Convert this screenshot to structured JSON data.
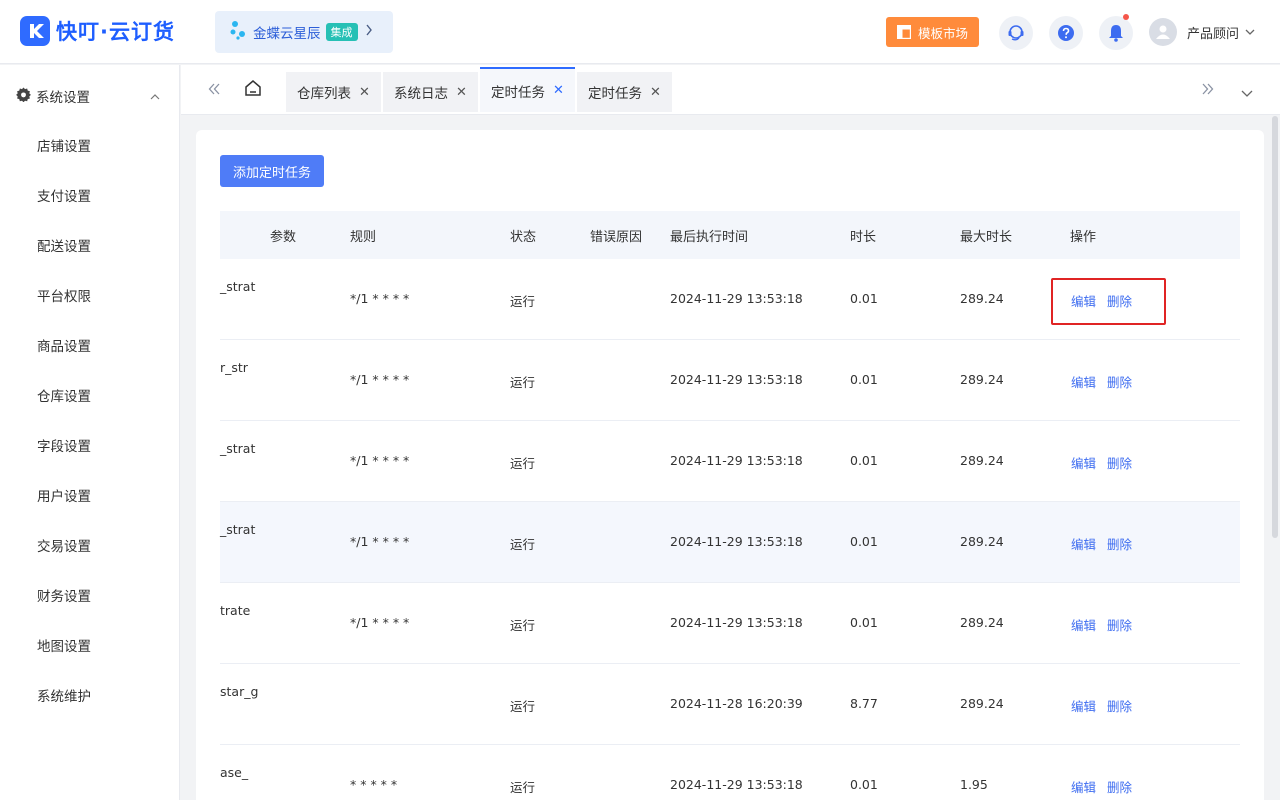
{
  "app": {
    "name": "快叮·云订货",
    "integration_label": "金蝶云星辰",
    "integration_badge": "集成",
    "market_button": "模板市场",
    "user_name": "产品顾问"
  },
  "sidebar": {
    "group_label": "系统设置",
    "items": [
      "店铺设置",
      "支付设置",
      "配送设置",
      "平台权限",
      "商品设置",
      "仓库设置",
      "字段设置",
      "用户设置",
      "交易设置",
      "财务设置",
      "地图设置",
      "系统维护"
    ]
  },
  "tabs": [
    {
      "label": "仓库列表",
      "active": false
    },
    {
      "label": "系统日志",
      "active": false
    },
    {
      "label": "定时任务",
      "active": true
    },
    {
      "label": "定时任务",
      "active": false
    }
  ],
  "main": {
    "add_button": "添加定时任务",
    "columns": [
      "参数",
      "规则",
      "状态",
      "错误原因",
      "最后执行时间",
      "时长",
      "最大时长",
      "操作"
    ],
    "rows": [
      {
        "param": "_strat",
        "rule": "*/1 * * * *",
        "status": "运行",
        "error": "",
        "last_run": "2024-11-29 13:53:18",
        "duration": "0.01",
        "max_duration": "289.24",
        "edit": "编辑",
        "delete": "删除"
      },
      {
        "param": "r_str",
        "rule": "*/1 * * * *",
        "status": "运行",
        "error": "",
        "last_run": "2024-11-29 13:53:18",
        "duration": "0.01",
        "max_duration": "289.24",
        "edit": "编辑",
        "delete": "删除"
      },
      {
        "param": "_strat",
        "rule": "*/1 * * * *",
        "status": "运行",
        "error": "",
        "last_run": "2024-11-29 13:53:18",
        "duration": "0.01",
        "max_duration": "289.24",
        "edit": "编辑",
        "delete": "删除"
      },
      {
        "param": "_strat",
        "rule": "*/1 * * * *",
        "status": "运行",
        "error": "",
        "last_run": "2024-11-29 13:53:18",
        "duration": "0.01",
        "max_duration": "289.24",
        "edit": "编辑",
        "delete": "删除"
      },
      {
        "param": "trate",
        "rule": "*/1 * * * *",
        "status": "运行",
        "error": "",
        "last_run": "2024-11-29 13:53:18",
        "duration": "0.01",
        "max_duration": "289.24",
        "edit": "编辑",
        "delete": "删除"
      },
      {
        "param": "star_g",
        "rule": "",
        "status": "运行",
        "error": "",
        "last_run": "2024-11-28 16:20:39",
        "duration": "8.77",
        "max_duration": "289.24",
        "edit": "编辑",
        "delete": "删除"
      },
      {
        "param": "ase_",
        "rule": "* * * * *",
        "status": "运行",
        "error": "",
        "last_run": "2024-11-29 13:53:18",
        "duration": "0.01",
        "max_duration": "1.95",
        "edit": "编辑",
        "delete": "删除"
      }
    ]
  },
  "colors": {
    "primary": "#4f7cf7",
    "accent_orange": "#ff8b3b",
    "highlight_red": "#e02424"
  },
  "icons": [
    "logo-icon",
    "integration-icon",
    "chevron-right-icon",
    "template-icon",
    "service-icon",
    "help-icon",
    "bell-icon",
    "user-avatar-icon",
    "chevron-down-icon",
    "gear-icon",
    "chevron-up-icon",
    "double-left-icon",
    "home-icon",
    "close-icon",
    "double-right-icon"
  ]
}
